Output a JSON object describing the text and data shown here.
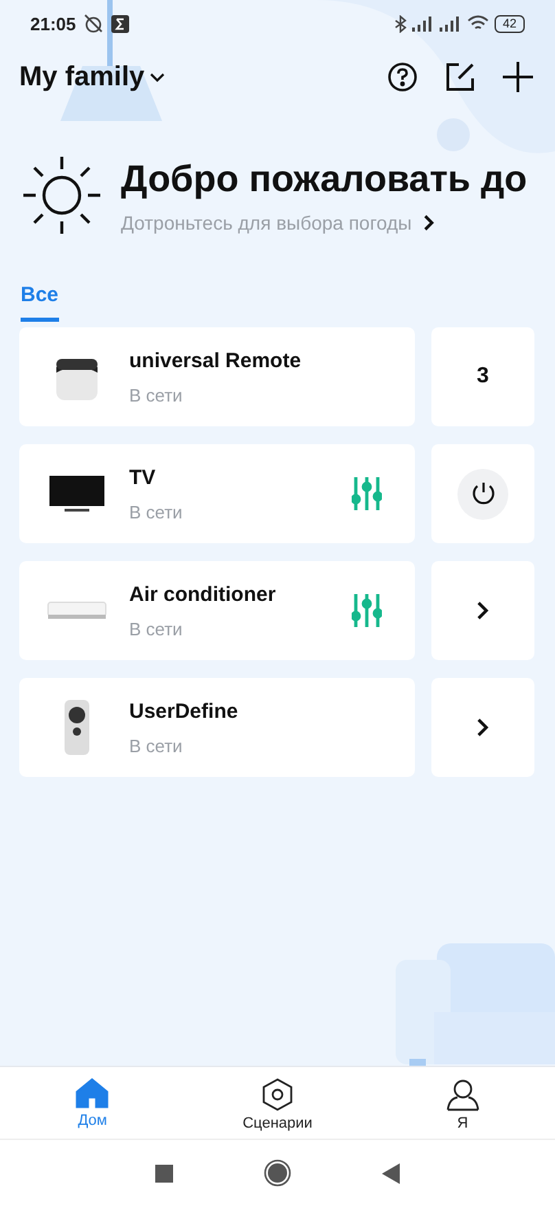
{
  "status_bar": {
    "time": "21:05",
    "battery": "42"
  },
  "header": {
    "family": "My family"
  },
  "weather": {
    "title": "Добро пожаловать до",
    "hint": "Дотроньтесь для выбора погоды"
  },
  "tabs": [
    {
      "label": "Все",
      "selected": true
    }
  ],
  "devices": [
    {
      "name": "universal Remote",
      "status": "В сети",
      "kind": "hub",
      "controls": false,
      "action": {
        "kind": "count",
        "text": "3"
      }
    },
    {
      "name": "TV",
      "status": "В сети",
      "kind": "tv",
      "controls": true,
      "action": {
        "kind": "power"
      }
    },
    {
      "name": "Air conditioner",
      "status": "В сети",
      "kind": "ac",
      "controls": true,
      "action": {
        "kind": "arrow"
      }
    },
    {
      "name": "UserDefine",
      "status": "В сети",
      "kind": "remote",
      "controls": false,
      "action": {
        "kind": "arrow"
      }
    }
  ],
  "bottom_nav": [
    {
      "label": "Дом",
      "kind": "home",
      "selected": true
    },
    {
      "label": "Сценарии",
      "kind": "scene",
      "selected": false
    },
    {
      "label": "Я",
      "kind": "user",
      "selected": false
    }
  ]
}
